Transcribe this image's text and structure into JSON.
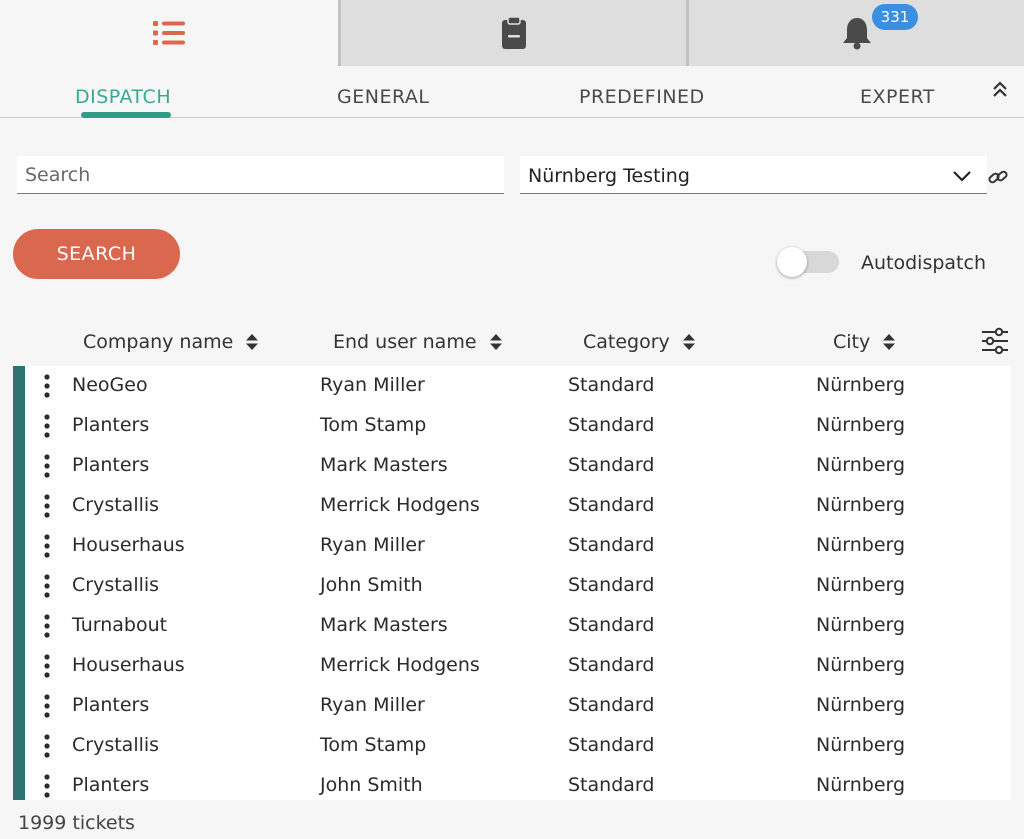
{
  "topbar": {
    "tabs": [
      {
        "icon": "list-icon",
        "active": true
      },
      {
        "icon": "clipboard-icon",
        "active": false
      },
      {
        "icon": "bell-icon",
        "active": false
      }
    ],
    "notification_count": "331"
  },
  "subtabs": {
    "items": [
      "DISPATCH",
      "GENERAL",
      "PREDEFINED",
      "EXPERT"
    ],
    "active": "DISPATCH"
  },
  "filters": {
    "search_placeholder": "Search",
    "location_selected": "Nürnberg Testing",
    "search_button": "SEARCH",
    "autodispatch_label": "Autodispatch",
    "autodispatch_on": false
  },
  "table": {
    "columns": [
      "Company name",
      "End user name",
      "Category",
      "City"
    ],
    "rows": [
      [
        "NeoGeo",
        "Ryan Miller",
        "Standard",
        "Nürnberg"
      ],
      [
        "Planters",
        "Tom Stamp",
        "Standard",
        "Nürnberg"
      ],
      [
        "Planters",
        "Mark Masters",
        "Standard",
        "Nürnberg"
      ],
      [
        "Crystallis",
        "Merrick Hodgens",
        "Standard",
        "Nürnberg"
      ],
      [
        "Houserhaus",
        "Ryan Miller",
        "Standard",
        "Nürnberg"
      ],
      [
        "Crystallis",
        "John Smith",
        "Standard",
        "Nürnberg"
      ],
      [
        "Turnabout",
        "Mark Masters",
        "Standard",
        "Nürnberg"
      ],
      [
        "Houserhaus",
        "Merrick Hodgens",
        "Standard",
        "Nürnberg"
      ],
      [
        "Planters",
        "Ryan Miller",
        "Standard",
        "Nürnberg"
      ],
      [
        "Crystallis",
        "Tom Stamp",
        "Standard",
        "Nürnberg"
      ],
      [
        "Planters",
        "John Smith",
        "Standard",
        "Nürnberg"
      ]
    ],
    "footer": "1999 tickets"
  },
  "colors": {
    "accent": "#3aaa8f",
    "primary_button": "#d9684f",
    "row_marker": "#2a7274",
    "badge": "#3a8fe0"
  }
}
